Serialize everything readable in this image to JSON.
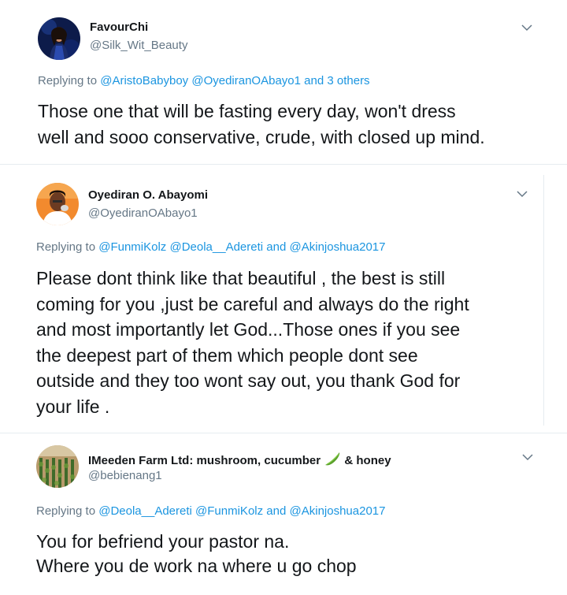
{
  "tweets": [
    {
      "name": "FavourChi",
      "handle": "@Silk_Wit_Beauty",
      "avatar_icon": "profile-photo-woman-dark-background",
      "reply_prefix": "Replying to",
      "reply_users": [
        "@AristoBabyboy",
        "@OyediranOAbayo1"
      ],
      "reply_and": "and",
      "reply_others": "3 others",
      "lines": [
        "Those one that will be fasting every day, won't dress",
        "well and sooo conservative, crude, with closed up mind."
      ]
    },
    {
      "name": "Oyediran O. Abayomi",
      "handle": "@OyediranOAbayo1",
      "avatar_icon": "profile-photo-man-orange-background",
      "reply_prefix": "Replying to",
      "reply_users": [
        "@FunmiKolz",
        "@Deola__Adereti"
      ],
      "reply_and": "and",
      "reply_last": "@Akinjoshua2017",
      "lines": [
        "Please dont think like that beautiful , the best is still",
        "coming for you ,just be careful and always do the right",
        "and most importantly let God...Those ones if you see",
        "the deepest part of them which people dont see",
        "outside and they too wont say out, you thank God for",
        "your life ."
      ]
    },
    {
      "name_before_emoji": "IMeeden Farm Ltd: mushroom, cucumber",
      "name_after_emoji": "& honey",
      "emoji_icon": "cucumber-emoji-icon",
      "handle": "@bebienang1",
      "avatar_icon": "profile-photo-farm-field",
      "reply_prefix": "Replying to",
      "reply_users": [
        "@Deola__Adereti",
        "@FunmiKolz"
      ],
      "reply_and": "and",
      "reply_last": "@Akinjoshua2017",
      "lines": [
        "You for befriend your pastor na.",
        "Where you de work na where u go chop"
      ]
    }
  ],
  "colors": {
    "link": "#1b95e0",
    "muted": "#657786",
    "text": "#14171a",
    "divider": "#e6ecf0"
  },
  "icons": [
    "chevron-down-icon"
  ]
}
